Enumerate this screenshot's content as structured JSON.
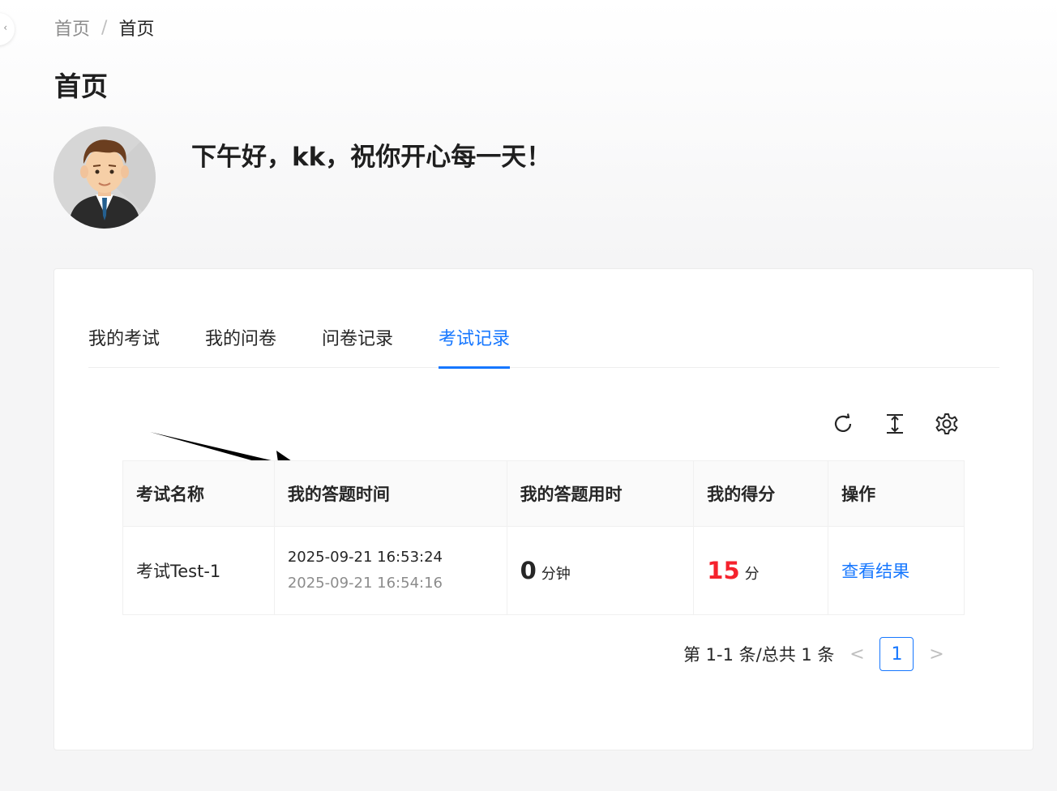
{
  "breadcrumb": {
    "root": "首页",
    "separator": "/",
    "current": "首页"
  },
  "page": {
    "title": "首页",
    "greeting": "下午好，kk，祝你开心每一天！"
  },
  "tabs": [
    {
      "label": "我的考试",
      "active": false
    },
    {
      "label": "我的问卷",
      "active": false
    },
    {
      "label": "问卷记录",
      "active": false
    },
    {
      "label": "考试记录",
      "active": true
    }
  ],
  "toolbar": {
    "icons": [
      "reload-icon",
      "column-height-icon",
      "setting-icon"
    ]
  },
  "table": {
    "headers": [
      "考试名称",
      "我的答题时间",
      "我的答题用时",
      "我的得分",
      "操作"
    ],
    "rows": [
      {
        "name": "考试Test-1",
        "start_time": "2025-09-21 16:53:24",
        "end_time": "2025-09-21 16:54:16",
        "duration": "0",
        "duration_unit": "分钟",
        "score": "15",
        "score_unit": "分",
        "action": "查看结果"
      }
    ]
  },
  "pagination": {
    "summary": "第 1-1 条/总共 1 条",
    "current_page": "1",
    "prev": "<",
    "next": ">"
  },
  "colors": {
    "accent": "#1677ff",
    "score": "#f5222d"
  }
}
